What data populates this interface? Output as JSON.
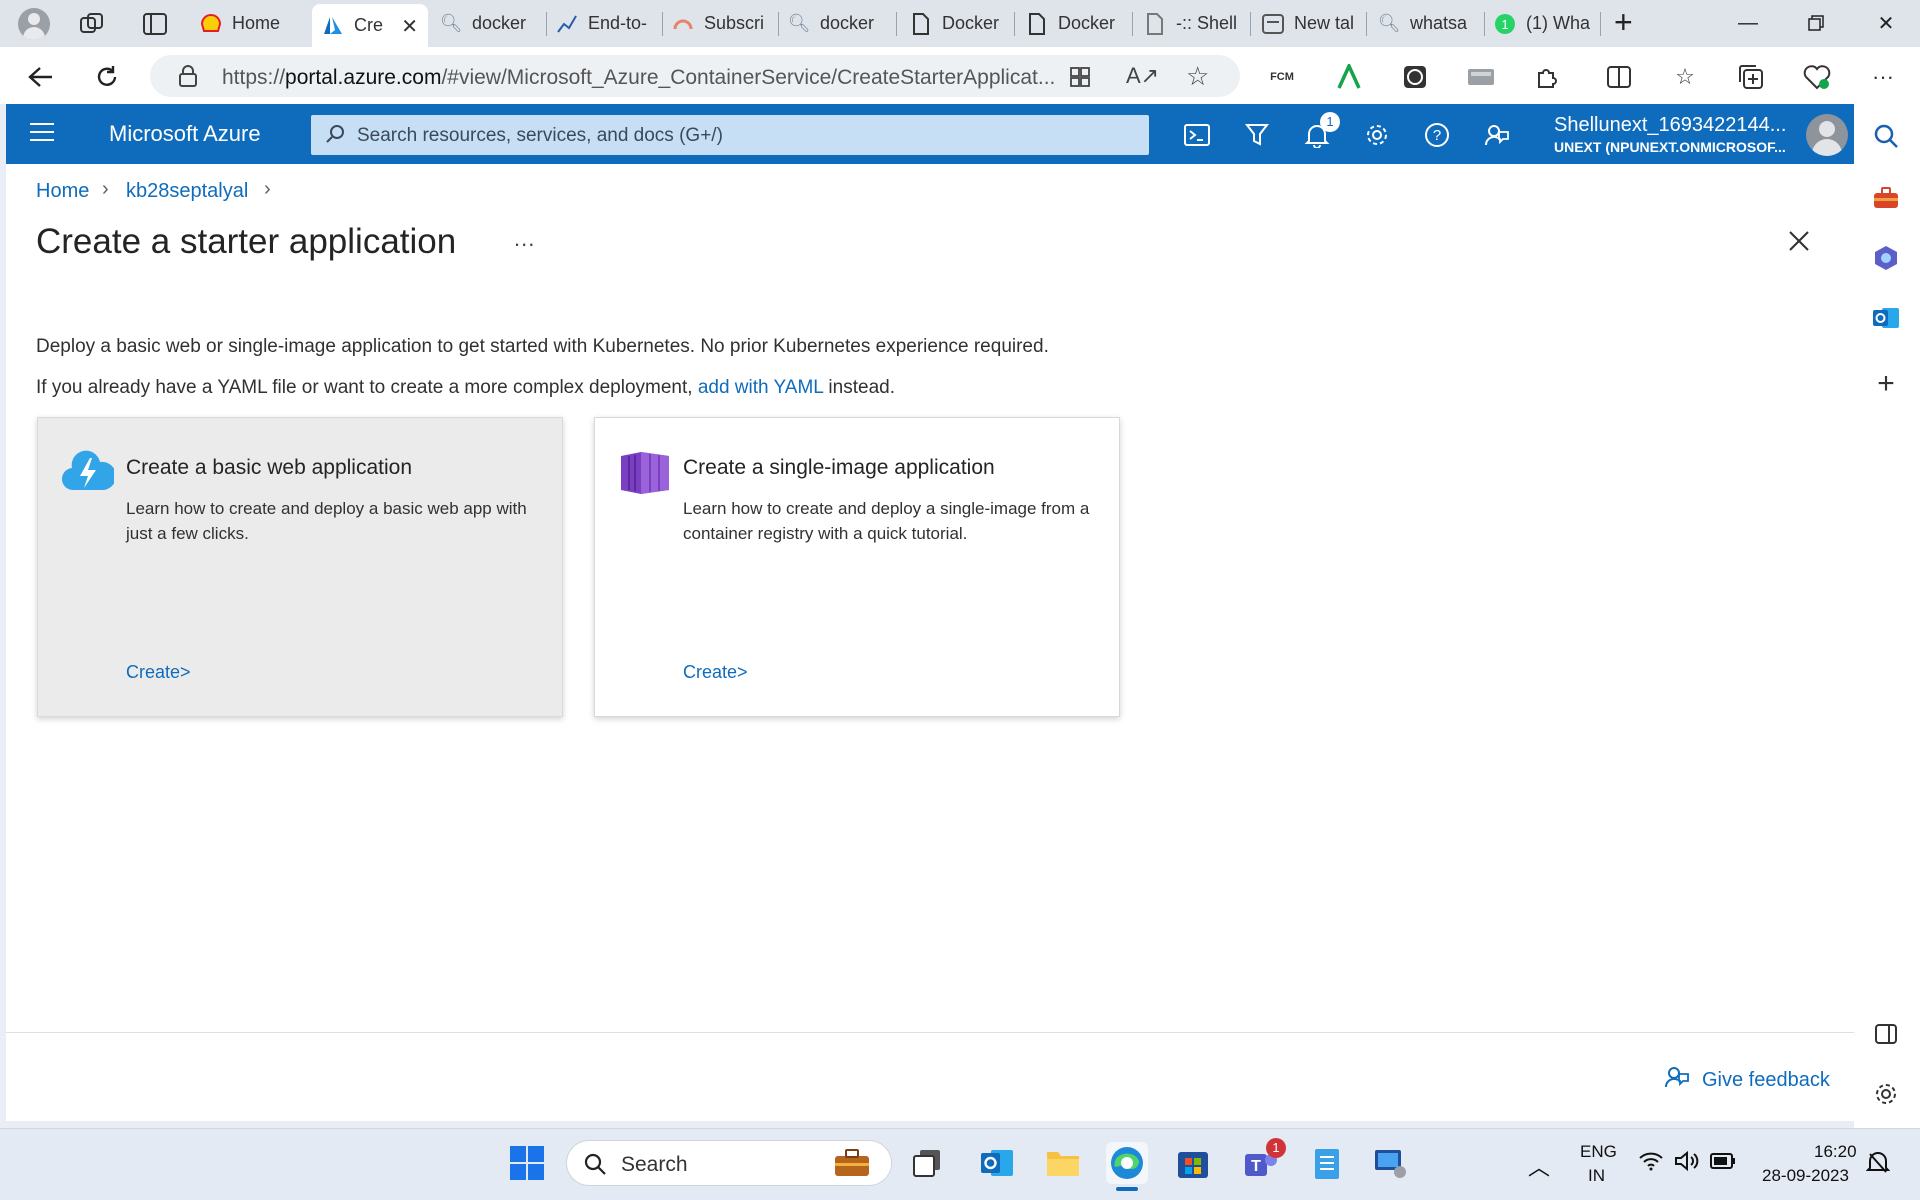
{
  "browser": {
    "tabs": [
      {
        "label": "Home",
        "icon": "shell-icon",
        "color": "#e31e24"
      },
      {
        "label": "Cre",
        "icon": "azure-icon",
        "active": true
      },
      {
        "label": "docker",
        "icon": "search-icon"
      },
      {
        "label": "End-to-",
        "icon": "chart-icon"
      },
      {
        "label": "Subscri",
        "icon": "arc-icon"
      },
      {
        "label": "docker",
        "icon": "search-icon"
      },
      {
        "label": "Docker",
        "icon": "page-icon"
      },
      {
        "label": "Docker",
        "icon": "page-icon"
      },
      {
        "label": "-:: Shell",
        "icon": "page-icon"
      },
      {
        "label": "New tal",
        "icon": "newtab-icon"
      },
      {
        "label": "whatsa",
        "icon": "search-icon"
      },
      {
        "label": "(1) Wha",
        "icon": "whatsapp-icon"
      }
    ],
    "new_tab": "+",
    "url_prefix": "https://",
    "url_host": "portal.azure.com",
    "url_rest": "/#view/Microsoft_Azure_ContainerService/CreateStarterApplicat...",
    "extension_fcm": "FCM"
  },
  "azure": {
    "brand": "Microsoft Azure",
    "search_placeholder": "Search resources, services, and docs (G+/)",
    "notification_count": "1",
    "account_name": "Shellunext_1693422144...",
    "account_directory": "UNEXT (NPUNEXT.ONMICROSOF..."
  },
  "breadcrumb": [
    "Home",
    "kb28septalyal"
  ],
  "page": {
    "title": "Create a starter application",
    "more": "...",
    "intro": "Deploy a basic web or single-image application to get started with Kubernetes. No prior Kubernetes experience required.",
    "yaml_before": "If you already have a YAML file or want to create a more complex deployment, ",
    "yaml_link": "add with YAML",
    "yaml_after": " instead."
  },
  "cards": [
    {
      "title": "Create a basic web application",
      "description": "Learn how to create and deploy a basic web app with just a few clicks.",
      "action": "Create>",
      "hovered": true
    },
    {
      "title": "Create a single-image application",
      "description": "Learn how to create and deploy a single-image from a container registry with a quick tutorial.",
      "action": "Create>",
      "hovered": false
    }
  ],
  "footer": {
    "feedback": "Give feedback"
  },
  "taskbar": {
    "search_label": "Search",
    "teams_badge": "1",
    "lang_top": "ENG",
    "lang_bottom": "IN",
    "time": "16:20",
    "date": "28-09-2023"
  },
  "colors": {
    "accent": "#0f6cbd",
    "header": "#0f6cbd",
    "card_hover": "#ebebeb"
  }
}
